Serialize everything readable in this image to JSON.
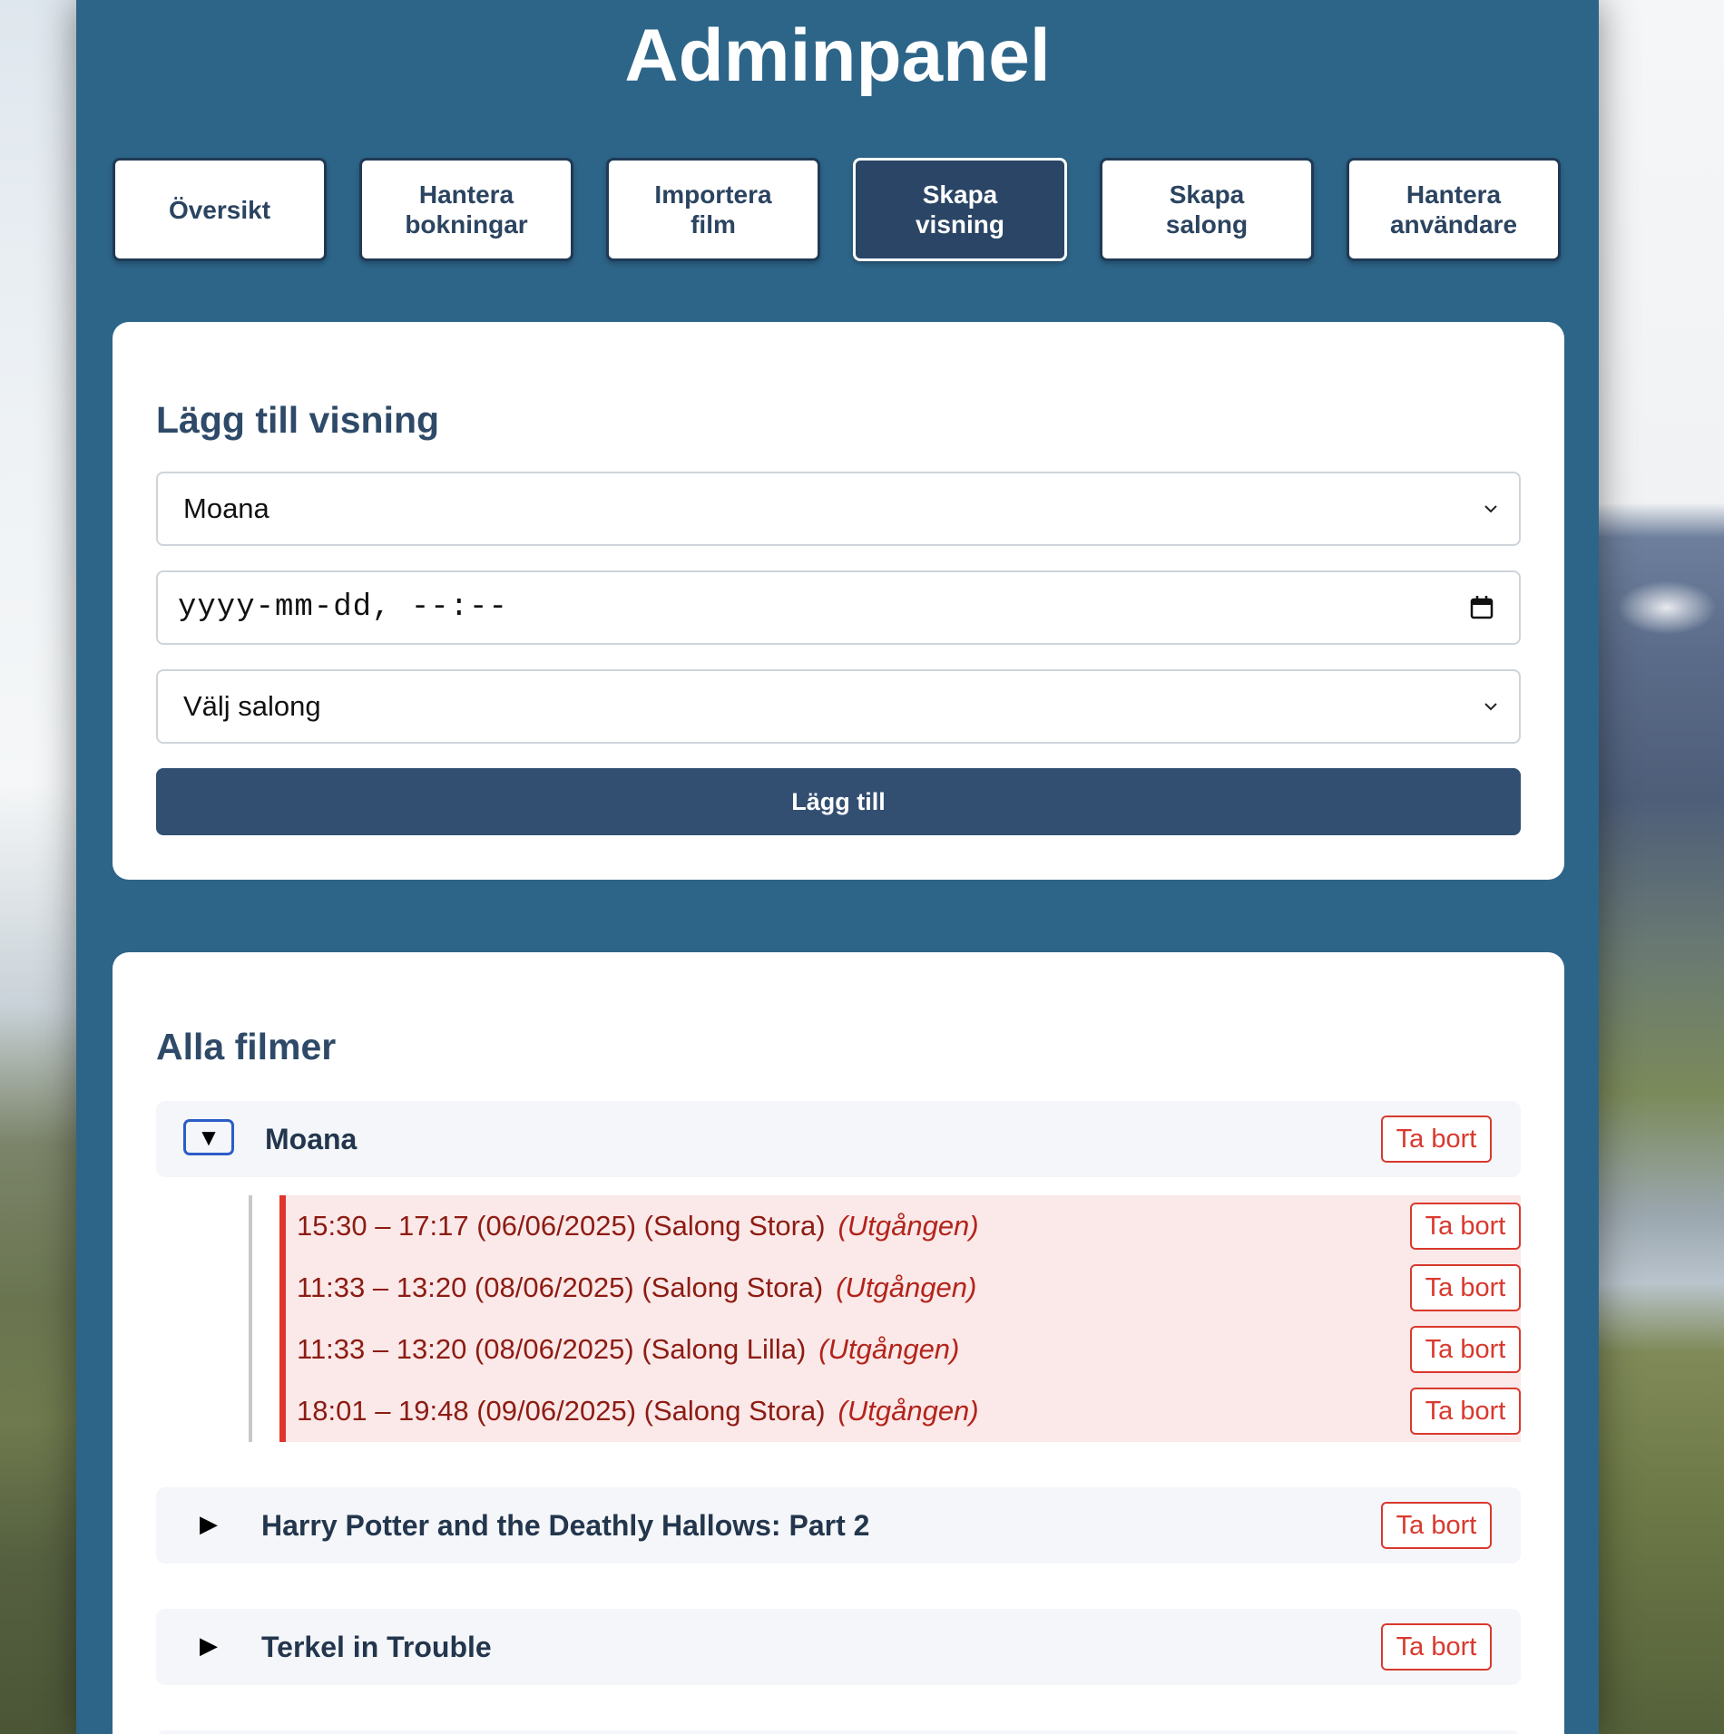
{
  "app": {
    "title": "Adminpanel"
  },
  "nav": {
    "items": [
      {
        "label": "Översikt",
        "active": false
      },
      {
        "label": "Hantera bokningar",
        "active": false
      },
      {
        "label": "Importera film",
        "active": false
      },
      {
        "label": "Skapa visning",
        "active": true
      },
      {
        "label": "Skapa salong",
        "active": false
      },
      {
        "label": "Hantera användare",
        "active": false
      }
    ]
  },
  "add_screening": {
    "heading": "Lägg till visning",
    "film_select": {
      "value": "Moana",
      "icon": "chevron-down-icon"
    },
    "datetime_input": {
      "placeholder": "yyyy-mm-dd, --:--",
      "icon": "calendar-icon"
    },
    "salon_select": {
      "value": "Välj salong",
      "icon": "chevron-down-icon"
    },
    "submit_label": "Lägg till"
  },
  "films": {
    "heading": "Alla filmer",
    "items": [
      {
        "title": "Moana",
        "expanded": true,
        "toggle_glyph": "▼",
        "delete_label": "Ta bort",
        "screenings": [
          {
            "text": "15:30 – 17:17 (06/06/2025) (Salong Stora)",
            "status": "(Utgången)",
            "delete_label": "Ta bort"
          },
          {
            "text": "11:33 – 13:20 (08/06/2025) (Salong Stora)",
            "status": "(Utgången)",
            "delete_label": "Ta bort"
          },
          {
            "text": "11:33 – 13:20 (08/06/2025) (Salong Lilla)",
            "status": "(Utgången)",
            "delete_label": "Ta bort"
          },
          {
            "text": "18:01 – 19:48 (09/06/2025) (Salong Stora)",
            "status": "(Utgången)",
            "delete_label": "Ta bort"
          }
        ]
      },
      {
        "title": "Harry Potter and the Deathly Hallows: Part 2",
        "expanded": false,
        "toggle_glyph": "▶",
        "delete_label": "Ta bort"
      },
      {
        "title": "Terkel in Trouble",
        "expanded": false,
        "toggle_glyph": "▶",
        "delete_label": "Ta bort"
      }
    ]
  },
  "colors": {
    "panel_bg": "#2d6589",
    "primary_button": "#324f72",
    "danger": "#d9392e",
    "expired_bg": "#fbe8e8"
  }
}
